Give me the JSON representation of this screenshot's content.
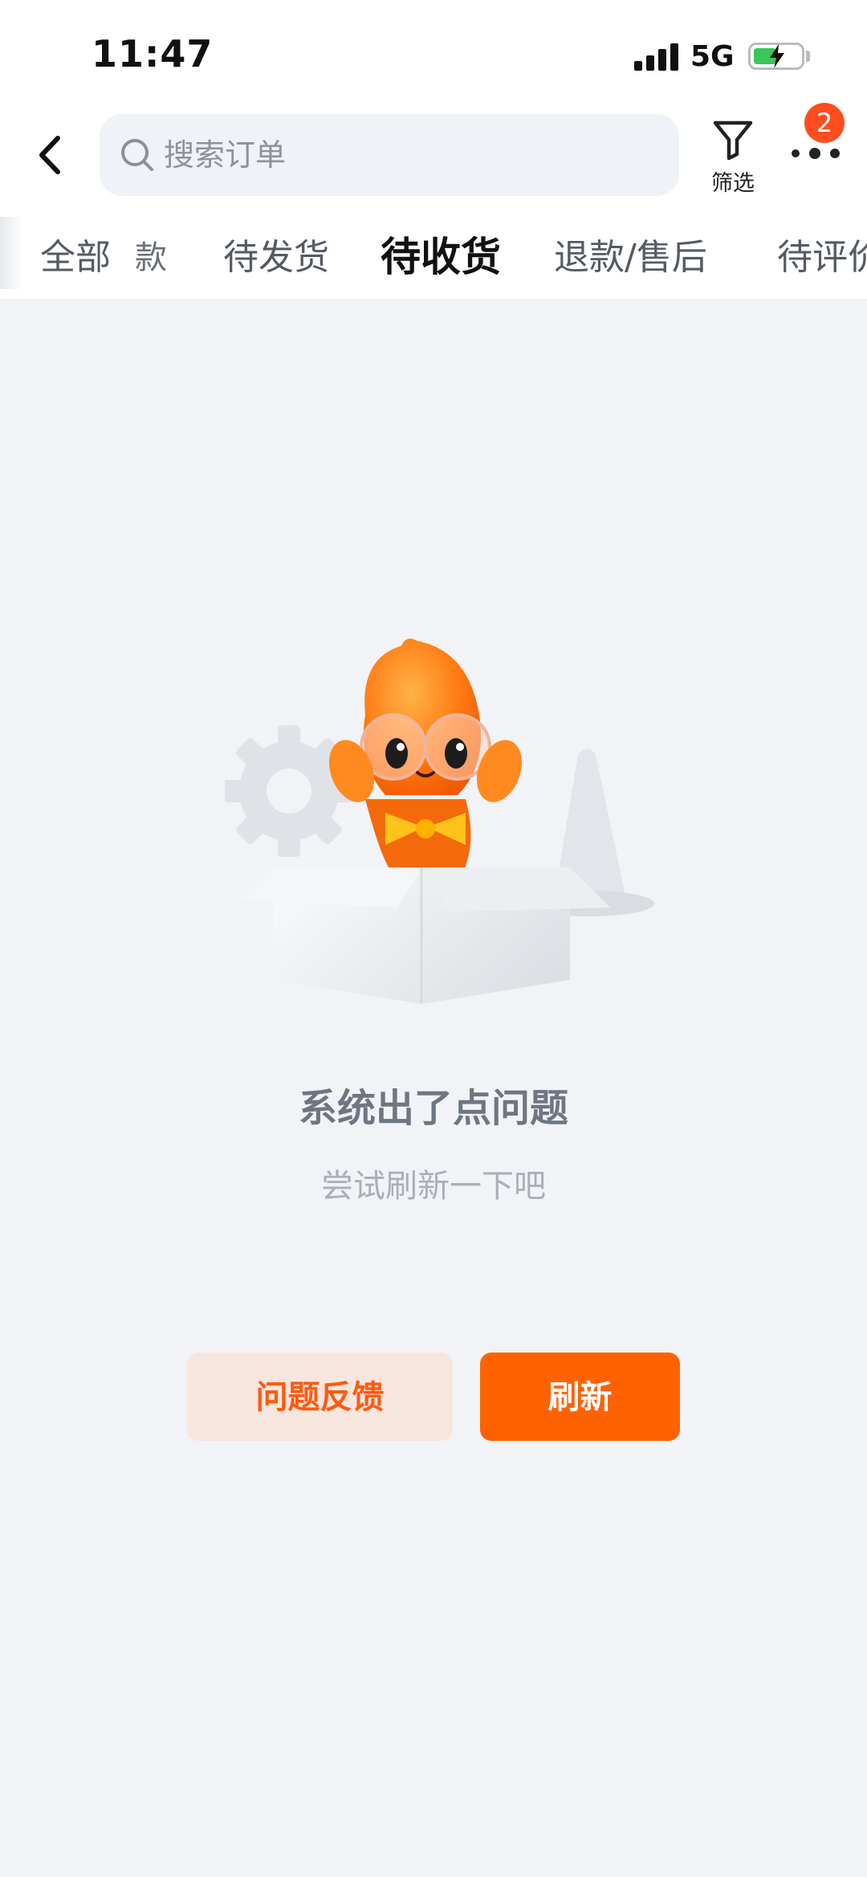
{
  "status_bar": {
    "time": "11:47",
    "network": "5G",
    "battery_charging": true
  },
  "header": {
    "back_icon": "chevron-left-icon",
    "search": {
      "placeholder": "搜索订单",
      "icon": "search-icon"
    },
    "filter": {
      "label": "筛选",
      "icon": "filter-funnel-icon"
    },
    "more": {
      "icon": "more-dots-icon",
      "badge": "2"
    }
  },
  "tabs": [
    {
      "label": "全部",
      "active": false
    },
    {
      "label": "款",
      "active": false
    },
    {
      "label": "待发货",
      "active": false
    },
    {
      "label": "待收货",
      "active": true
    },
    {
      "label": "退款/售后",
      "active": false
    },
    {
      "label": "待评价",
      "active": false
    }
  ],
  "error": {
    "illustration": "mascot-box-gear-illustration",
    "title": "系统出了点问题",
    "subtitle": "尝试刷新一下吧"
  },
  "actions": {
    "feedback_label": "问题反馈",
    "refresh_label": "刷新"
  },
  "colors": {
    "accent": "#ff6200",
    "badge": "#ff4d1f",
    "background": "#f1f3f6"
  }
}
